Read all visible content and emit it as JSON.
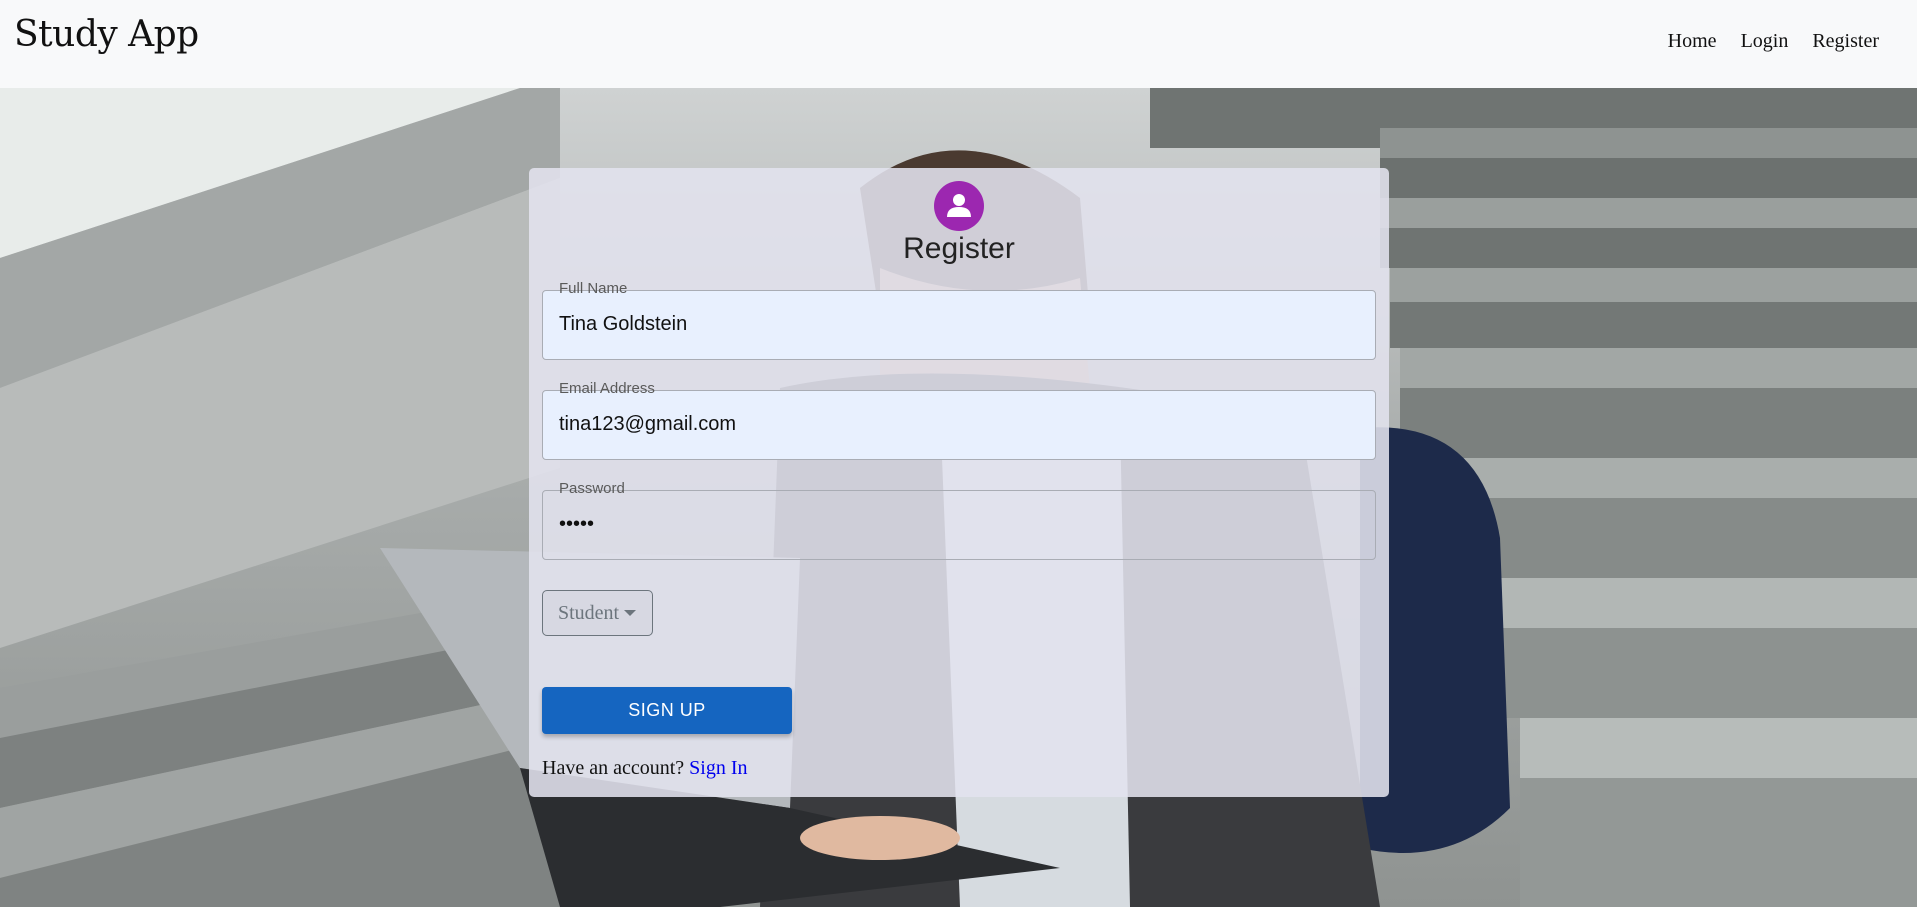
{
  "app": {
    "brand": "Study App"
  },
  "nav": {
    "items": [
      {
        "label": "Home"
      },
      {
        "label": "Login"
      },
      {
        "label": "Register"
      }
    ]
  },
  "form": {
    "title": "Register",
    "icon": "person-icon",
    "accent_color": "#9c27b0",
    "fields": {
      "full_name": {
        "label": "Full Name",
        "value": "Tina Goldstein"
      },
      "email": {
        "label": "Email Address",
        "value": "tina123@gmail.com"
      },
      "password": {
        "label": "Password",
        "value": "•••••"
      }
    },
    "role_select": {
      "selected": "Student"
    },
    "submit_label": "SIGN UP",
    "submit_color": "#1565c0",
    "account_prompt": "Have an account?",
    "signin_label": "Sign In"
  },
  "background": {
    "image": "student-on-steps-with-laptop"
  }
}
